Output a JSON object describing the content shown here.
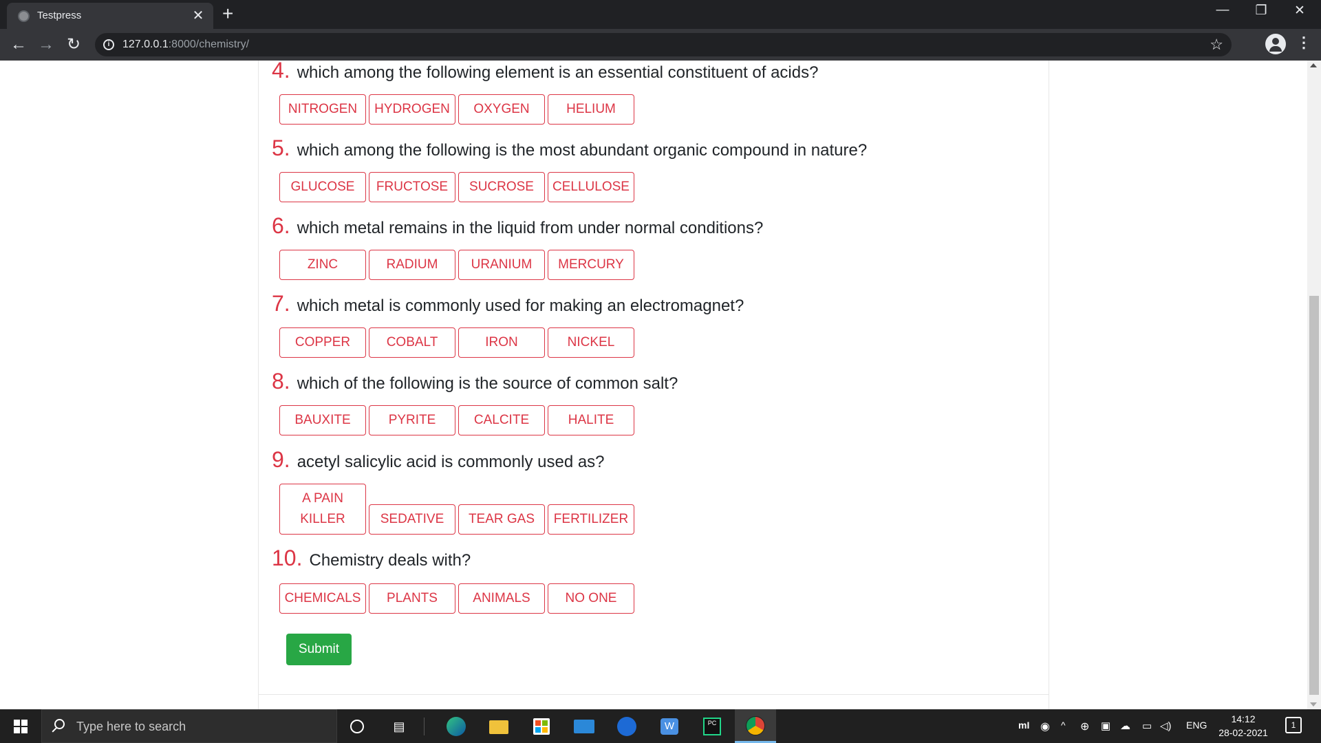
{
  "browser": {
    "tab_title": "Testpress",
    "tab_close": "✕",
    "new_tab": "+",
    "url_host": "127.0.0.1",
    "url_path": ":8000/chemistry/",
    "window_minimize": "—",
    "window_restore": "❐",
    "window_close": "✕"
  },
  "quiz": {
    "questions": [
      {
        "number": "4",
        "text": "which among the following element is an essential constituent of acids?",
        "options": [
          "NITROGEN",
          "HYDROGEN",
          "OXYGEN",
          "HELIUM"
        ]
      },
      {
        "number": "5",
        "text": "which among the following is the most abundant organic compound in nature?",
        "options": [
          "GLUCOSE",
          "FRUCTOSE",
          "SUCROSE",
          "CELLULOSE"
        ]
      },
      {
        "number": "6",
        "text": "which metal remains in the liquid from under normal conditions?",
        "options": [
          "ZINC",
          "RADIUM",
          "URANIUM",
          "MERCURY"
        ]
      },
      {
        "number": "7",
        "text": "which metal is commonly used for making an electromagnet?",
        "options": [
          "COPPER",
          "COBALT",
          "IRON",
          "NICKEL"
        ]
      },
      {
        "number": "8",
        "text": "which of the following is the source of common salt?",
        "options": [
          "BAUXITE",
          "PYRITE",
          "CALCITE",
          "HALITE"
        ]
      },
      {
        "number": "9",
        "text": "acetyl salicylic acid is commonly used as?",
        "options": [
          "A PAIN KILLER",
          "SEDATIVE",
          "TEAR GAS",
          "FERTILIZER"
        ]
      },
      {
        "number": "10",
        "text": "Chemistry deals with?",
        "options": [
          "CHEMICALS",
          "PLANTS",
          "ANIMALS",
          "NO ONE"
        ]
      }
    ],
    "submit_label": "Submit"
  },
  "taskbar": {
    "search_placeholder": "Type here to search",
    "tray_mi": "mI",
    "language": "ENG",
    "time": "14:12",
    "date": "28-02-2021",
    "notification_count": "1"
  },
  "colors": {
    "accent_red": "#dc3545",
    "submit_green": "#28a745"
  }
}
